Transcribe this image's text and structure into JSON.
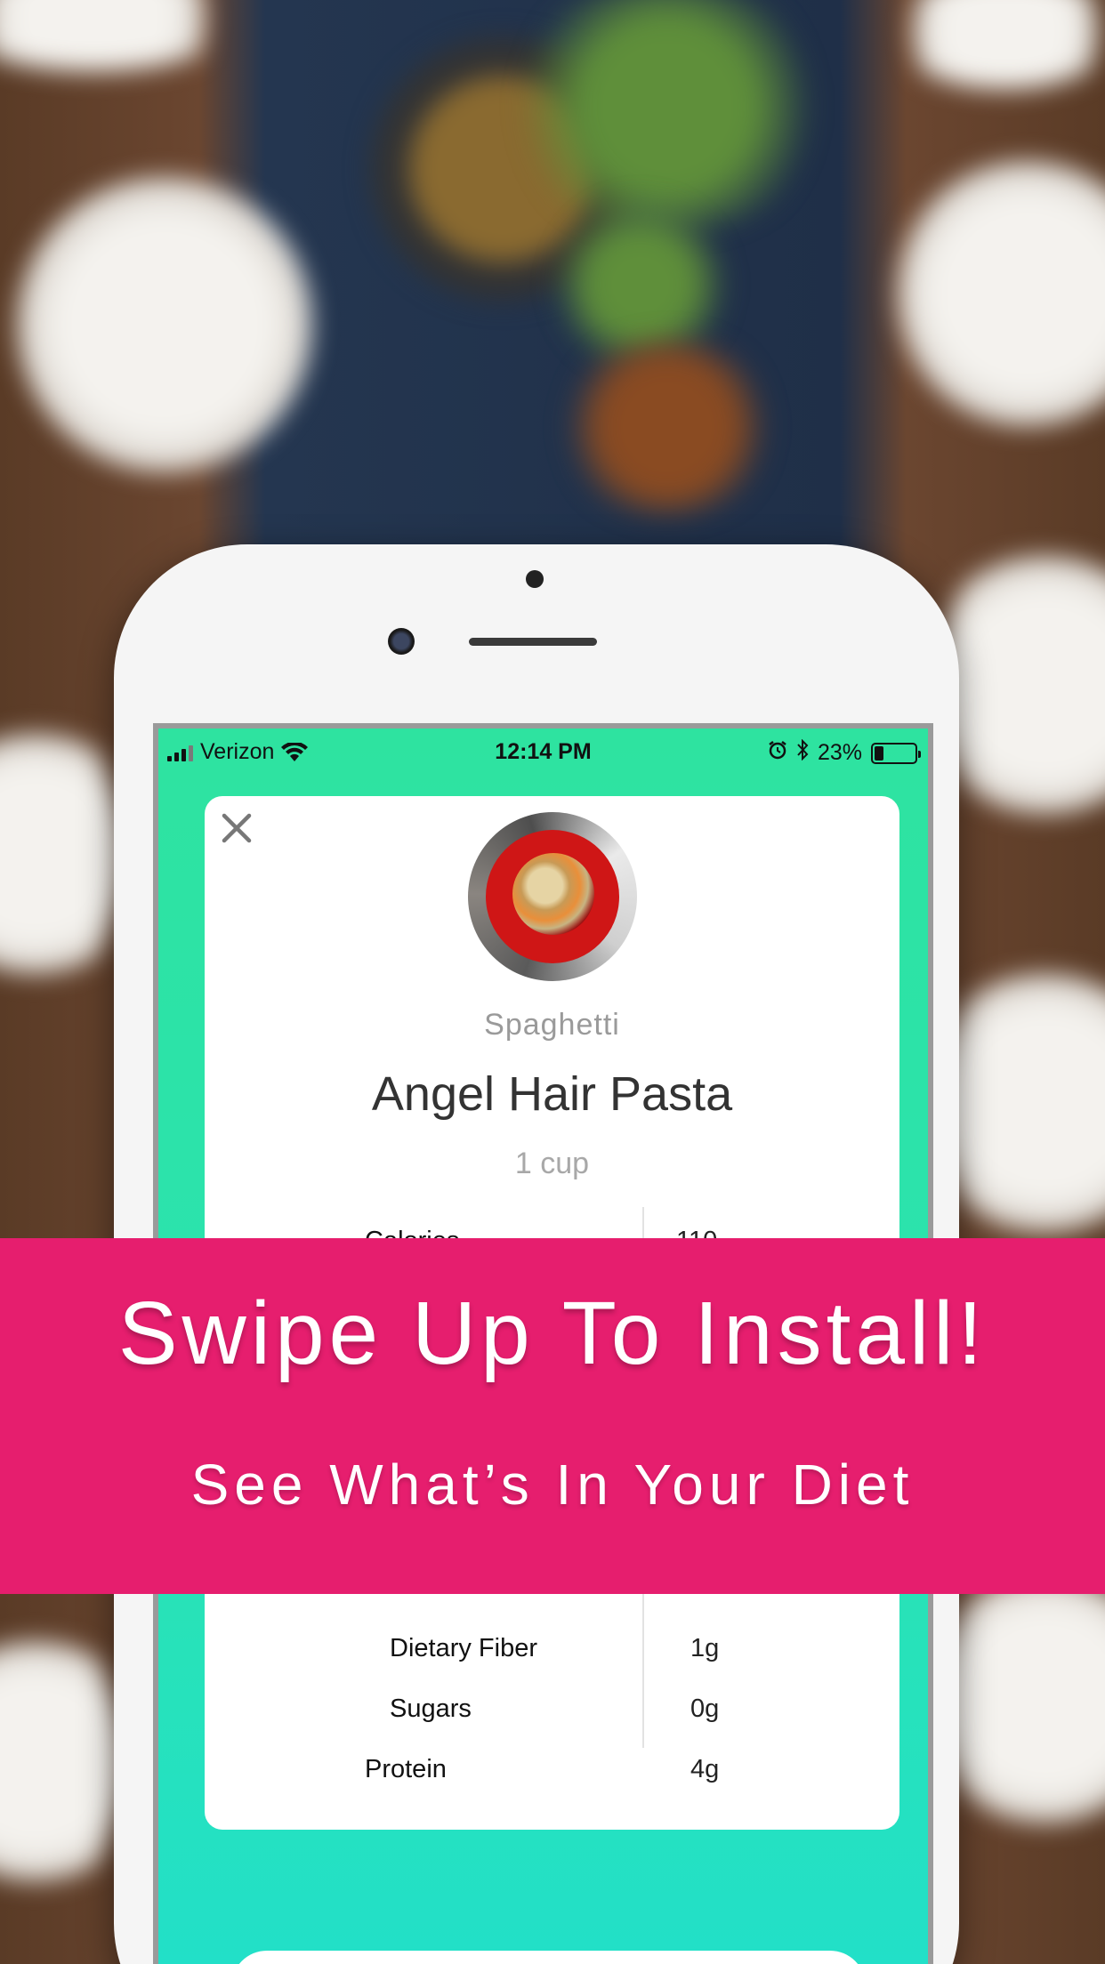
{
  "status_bar": {
    "carrier": "Verizon",
    "time": "12:14 PM",
    "battery_percent": "23%",
    "battery_level": 0.23,
    "icons": [
      "signal-icon",
      "wifi-icon",
      "alarm-icon",
      "bluetooth-icon",
      "battery-icon"
    ]
  },
  "card": {
    "close_icon": "close-icon",
    "food_category": "Spaghetti",
    "food_name": "Angel Hair Pasta",
    "serving": "1 cup",
    "nutrition": [
      {
        "label": "Calories",
        "value": "110"
      },
      {
        "label": "Dietary Fiber",
        "value": "1g"
      },
      {
        "label": "Sugars",
        "value": "0g"
      },
      {
        "label": "Protein",
        "value": "4g"
      }
    ]
  },
  "banner": {
    "title": "Swipe Up To Install!",
    "subtitle": "See What’s In Your Diet"
  },
  "colors": {
    "banner": "#e61e6e",
    "screen_bg": "#2ee3a0",
    "card_bg": "#ffffff"
  }
}
